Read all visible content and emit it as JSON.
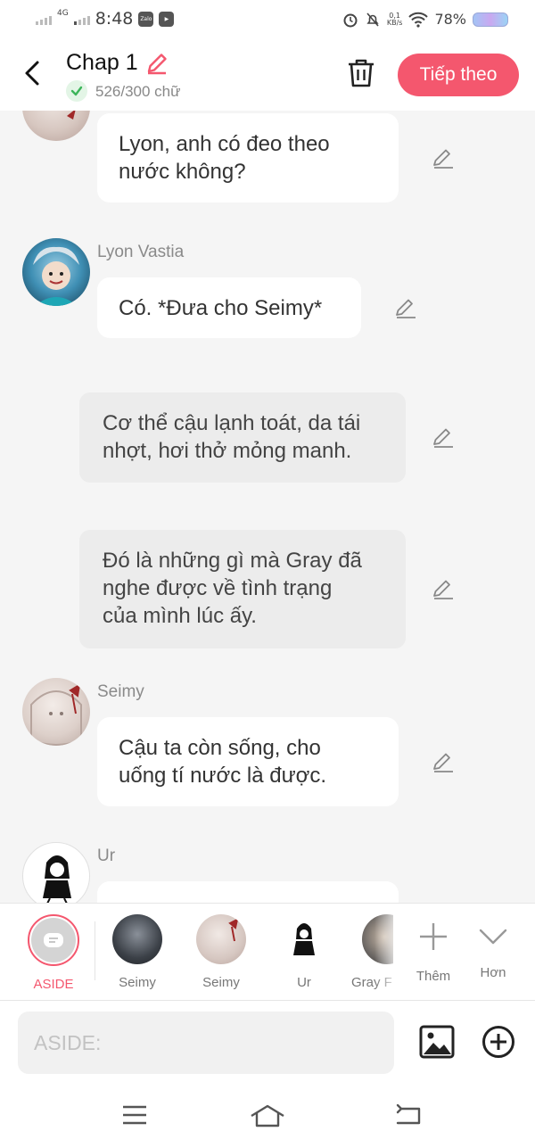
{
  "status_bar": {
    "network": "4G",
    "time": "8:48",
    "speed_value": "0,1",
    "speed_unit": "KB/s",
    "battery": "78%",
    "app_icons": [
      "zalo-icon",
      "video-icon"
    ]
  },
  "header": {
    "title": "Chap 1",
    "word_count": "526/300 chữ",
    "next_label": "Tiếp theo"
  },
  "colors": {
    "accent": "#f4576e",
    "check_green": "#3cb55a",
    "narration_bg": "#ececec"
  },
  "messages": [
    {
      "type": "character",
      "name": "",
      "text_lines": [
        "Lyon, anh có đeo theo",
        "nước không?"
      ],
      "avatar": "seimy-avatar"
    },
    {
      "type": "character",
      "name": "Lyon Vastia",
      "text_lines": [
        "Có. *Đưa cho Seimy*"
      ],
      "avatar": "lyon-avatar"
    },
    {
      "type": "narration",
      "text_lines": [
        "Cơ thể cậu lạnh toát, da tái",
        "nhợt, hơi thở mỏng manh."
      ]
    },
    {
      "type": "narration",
      "text_lines": [
        "Đó là những gì mà Gray đã",
        "nghe được về tình trạng",
        "của mình lúc ấy."
      ]
    },
    {
      "type": "character",
      "name": "Seimy",
      "text_lines": [
        "Cậu ta còn sống, cho",
        "uống tí nước là được."
      ],
      "avatar": "seimy-avatar"
    },
    {
      "type": "character",
      "name": "Ur",
      "text_lines": [],
      "avatar": "ur-avatar"
    }
  ],
  "characters": [
    {
      "label": "ASIDE",
      "selected": true
    },
    {
      "label": "Seimy"
    },
    {
      "label": "Seimy"
    },
    {
      "label": "Ur"
    },
    {
      "label": "Gray F"
    }
  ],
  "char_actions": {
    "more": "Thêm",
    "expand": "Hơn"
  },
  "input": {
    "placeholder": "ASIDE:"
  }
}
